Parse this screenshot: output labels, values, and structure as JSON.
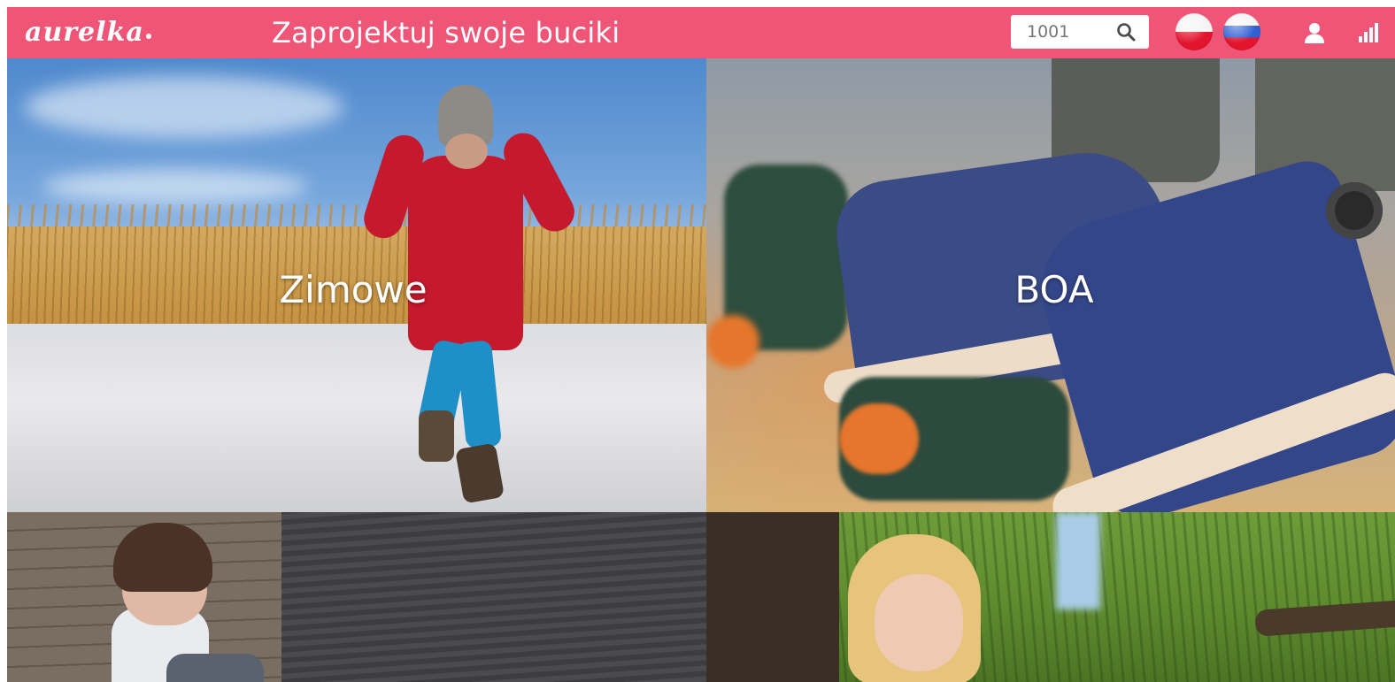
{
  "header": {
    "logo_text": "aurelka",
    "title": "Zaprojektuj swoje buciki",
    "search": {
      "value": "",
      "placeholder": "1001"
    },
    "languages": [
      {
        "code": "pl",
        "icon": "poland-flag-icon"
      },
      {
        "code": "ru",
        "icon": "russia-flag-icon"
      }
    ],
    "icons": {
      "search": "search-icon",
      "user": "user-icon",
      "signal": "signal-bars-icon"
    },
    "colors": {
      "header_bg": "#ef5576",
      "text": "#ffffff"
    }
  },
  "tiles": [
    {
      "label": "Zimowe"
    },
    {
      "label": "BOA"
    },
    {
      "label": ""
    },
    {
      "label": ""
    }
  ]
}
